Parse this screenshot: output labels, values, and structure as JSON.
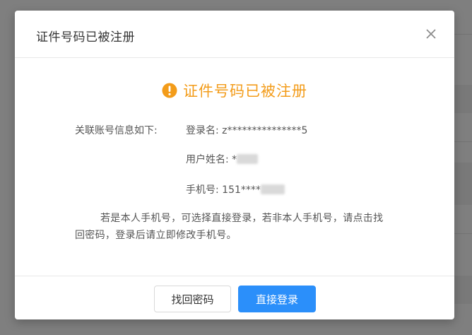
{
  "modal": {
    "title": "证件号码已被注册",
    "close_icon": "close-icon"
  },
  "content": {
    "headline": "证件号码已被注册",
    "warning_icon": "warning-circle-icon",
    "warning_color": "#f39c1a",
    "info_label": "关联账号信息如下:",
    "login_name_label": "登录名:",
    "login_name_value": "z***************5",
    "user_name_label": "用户姓名:",
    "user_name_value": "*",
    "phone_label": "手机号:",
    "phone_value": "151****",
    "notice_text": "若是本人手机号，可选择直接登录，若非本人手机号，请点击找回密码，登录后请立即修改手机号。"
  },
  "footer": {
    "recover_button": "找回密码",
    "login_button": "直接登录",
    "primary_color": "#2b8ffa"
  }
}
